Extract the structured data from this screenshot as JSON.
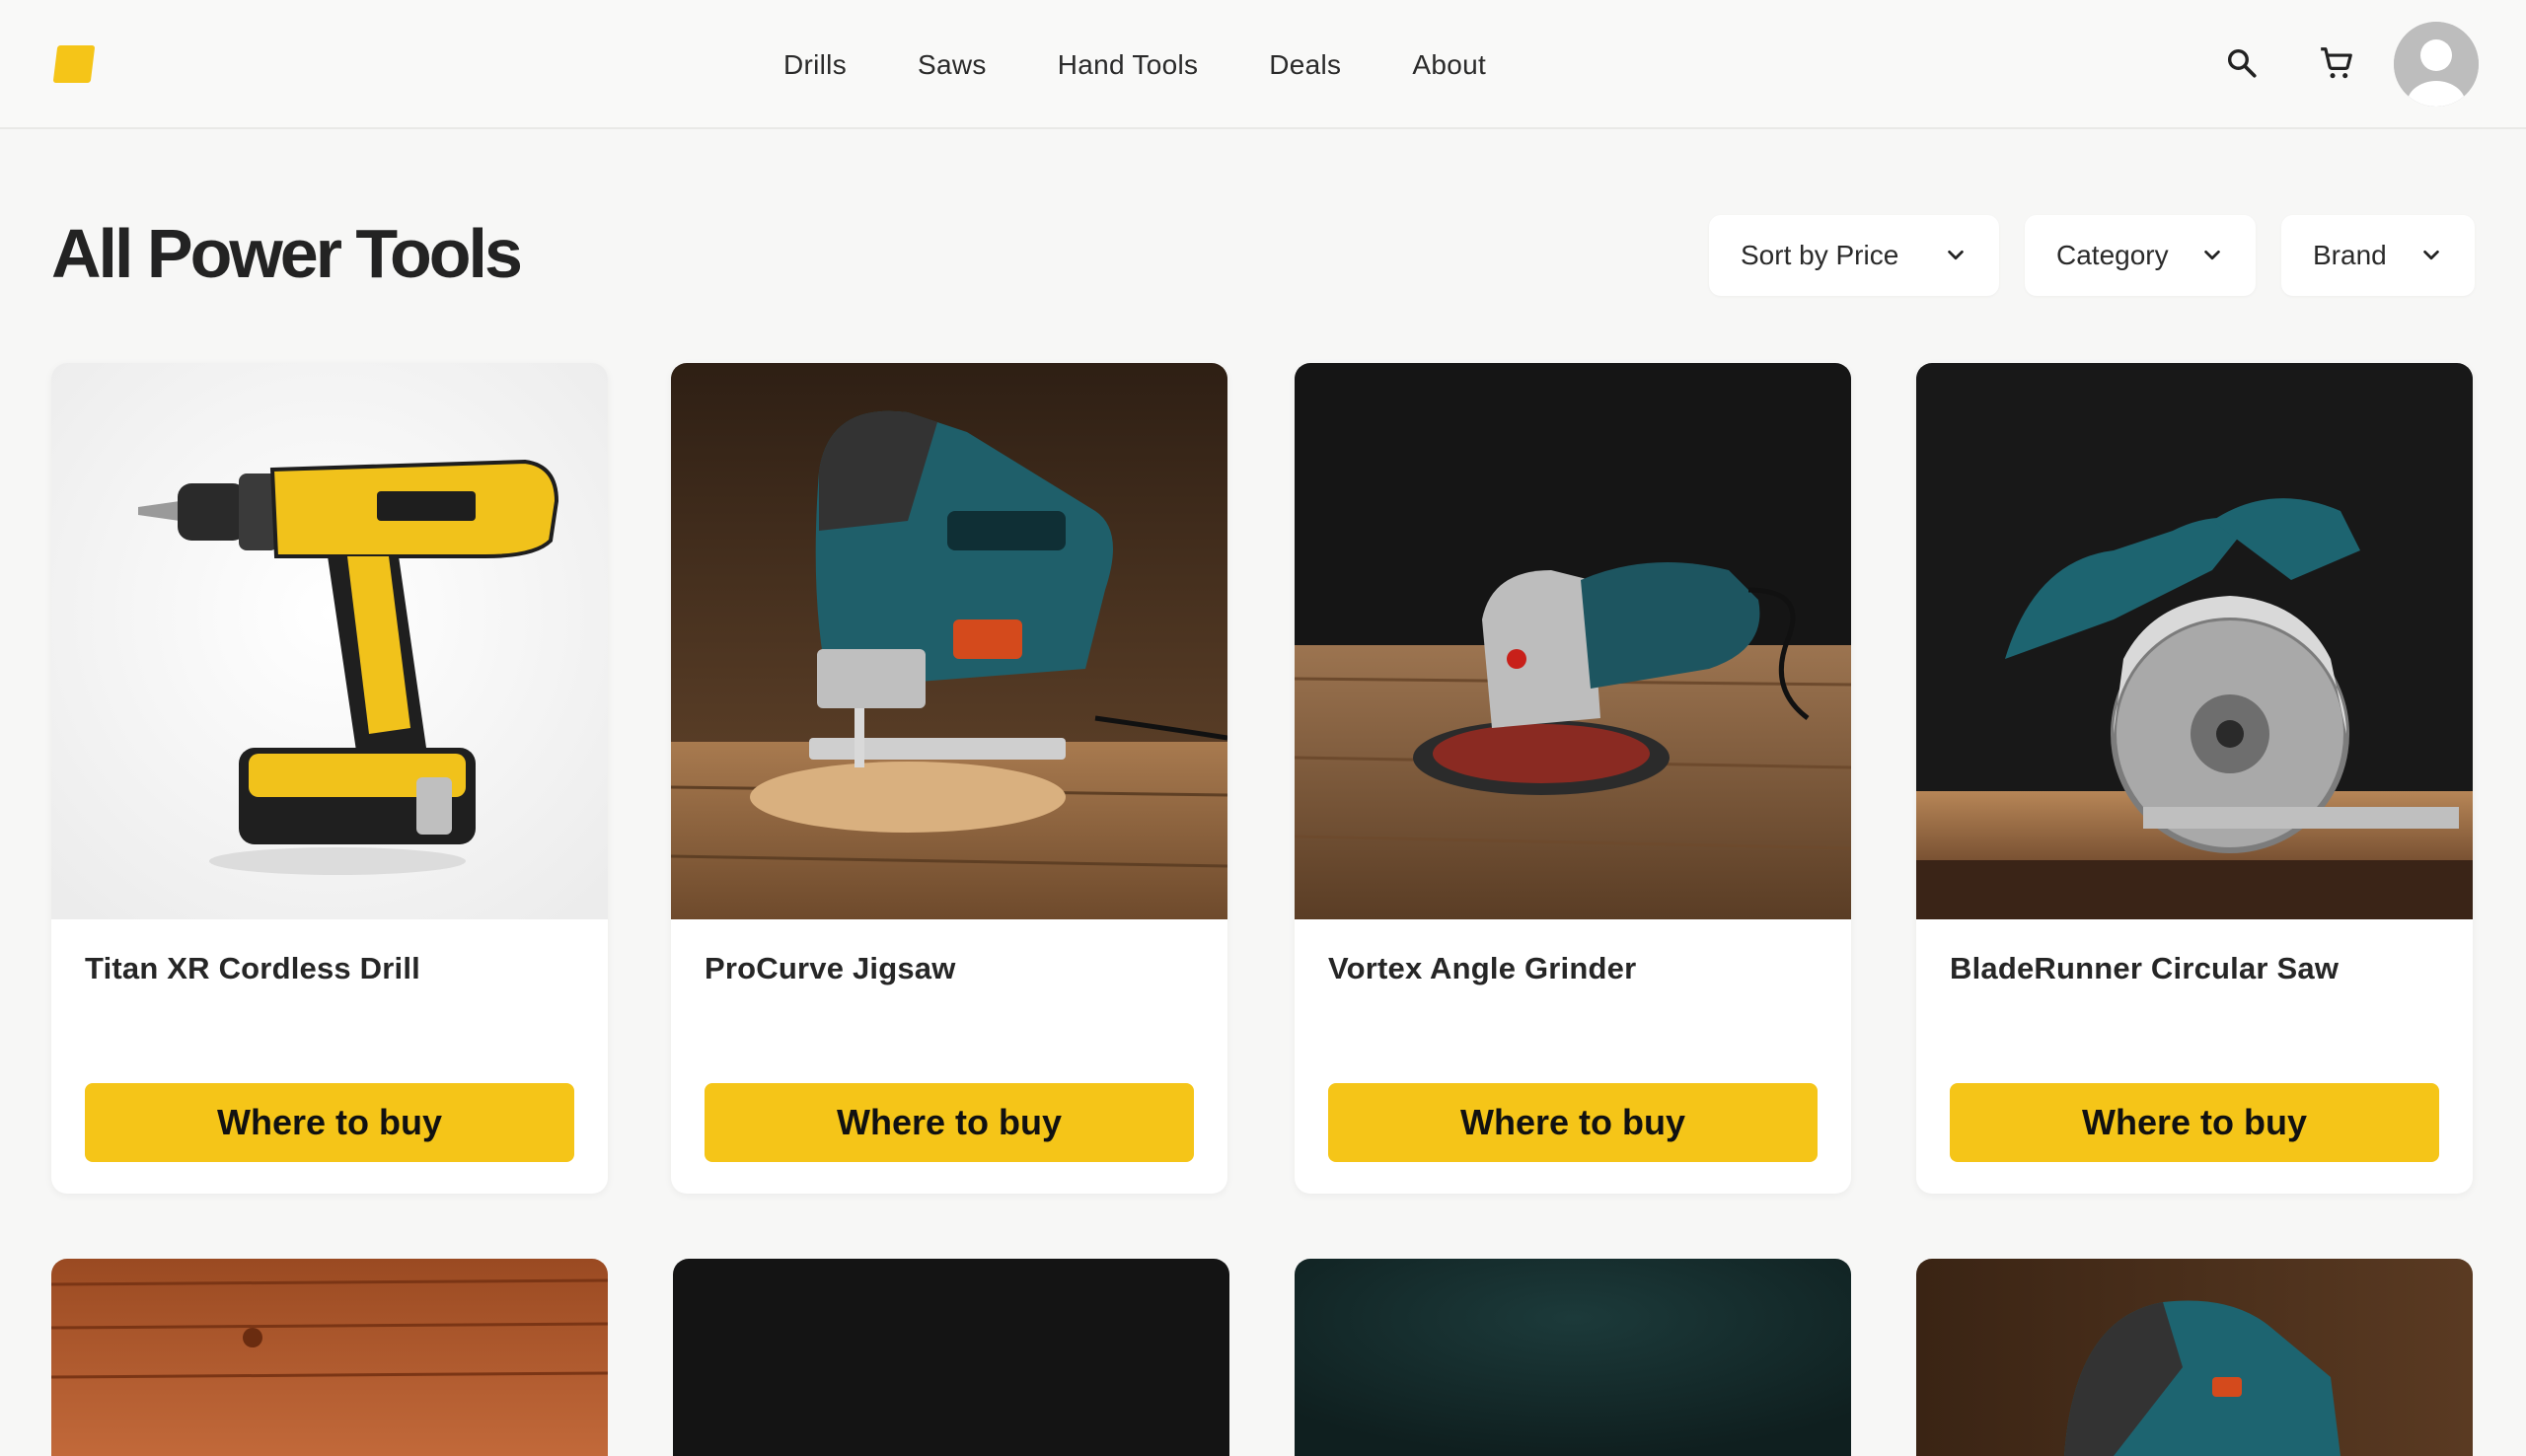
{
  "nav": {
    "links": [
      "Drills",
      "Saws",
      "Hand Tools",
      "Deals",
      "About"
    ],
    "icons": [
      "search-icon",
      "cart-icon",
      "user-avatar"
    ]
  },
  "page": {
    "title": "All Power Tools"
  },
  "filters": {
    "sort_label": "Sort by Price",
    "category_label": "Category",
    "brand_label": "Brand"
  },
  "products": [
    {
      "name": "Titan XR Cordless Drill",
      "cta": "Where to buy"
    },
    {
      "name": "ProCurve Jigsaw",
      "cta": "Where to buy"
    },
    {
      "name": "Vortex Angle Grinder",
      "cta": "Where to buy"
    },
    {
      "name": "BladeRunner Circular Saw",
      "cta": "Where to buy"
    }
  ],
  "colors": {
    "accent": "#f5c518",
    "background": "#f7f7f6",
    "card": "#ffffff",
    "text": "#232323"
  }
}
